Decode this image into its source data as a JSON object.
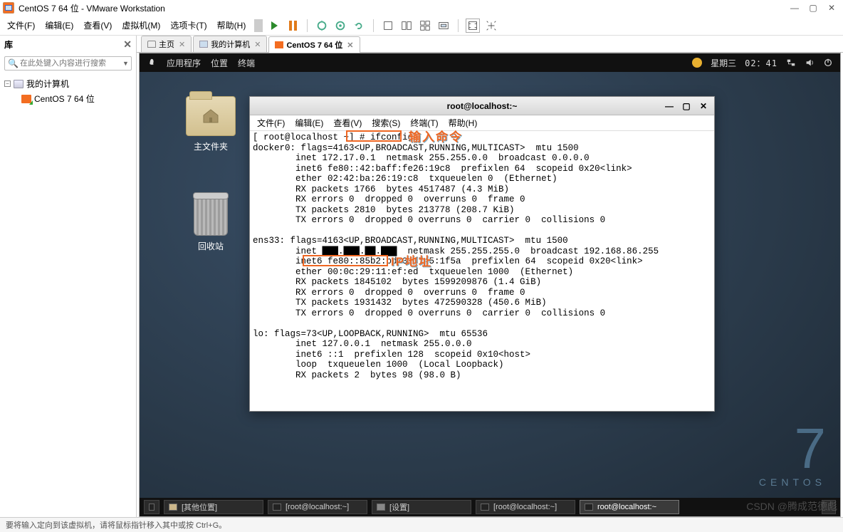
{
  "app": {
    "title": "CentOS 7 64 位 - VMware Workstation"
  },
  "win_controls": {
    "min": "—",
    "max": "▢",
    "close": "✕"
  },
  "menu": {
    "file": "文件(F)",
    "edit": "编辑(E)",
    "view": "查看(V)",
    "vm": "虚拟机(M)",
    "tabs": "选项卡(T)",
    "help": "帮助(H)"
  },
  "sidebar": {
    "title": "库",
    "search_placeholder": "在此处键入内容进行搜索",
    "root": "我的计算机",
    "vm": "CentOS 7 64 位"
  },
  "tabs": {
    "home": "主页",
    "mypc": "我的计算机",
    "vm": "CentOS 7 64 位"
  },
  "gnome": {
    "apps": "应用程序",
    "places": "位置",
    "terminal": "终端",
    "day": "星期三",
    "time": "02：41"
  },
  "desktop": {
    "home": "主文件夹",
    "trash": "回收站"
  },
  "centos": {
    "seven": "7",
    "word": "CENTOS"
  },
  "term": {
    "title": "root@localhost:~",
    "menu": {
      "file": "文件(F)",
      "edit": "编辑(E)",
      "view": "查看(V)",
      "search": "搜索(S)",
      "terminal": "终端(T)",
      "help": "帮助(H)"
    },
    "prompt": "[ root@localhost ~] # ifconfig",
    "output_lines": [
      "docker0: flags=4163<UP,BROADCAST,RUNNING,MULTICAST>  mtu 1500",
      "        inet 172.17.0.1  netmask 255.255.0.0  broadcast 0.0.0.0",
      "        inet6 fe80::42:baff:fe26:19c8  prefixlen 64  scopeid 0x20<link>",
      "        ether 02:42:ba:26:19:c8  txqueuelen 0  (Ethernet)",
      "        RX packets 1766  bytes 4517487 (4.3 MiB)",
      "        RX errors 0  dropped 0  overruns 0  frame 0",
      "        TX packets 2810  bytes 213778 (208.7 KiB)",
      "        TX errors 0  dropped 0 overruns 0  carrier 0  collisions 0",
      "",
      "ens33: flags=4163<UP,BROADCAST,RUNNING,MULTICAST>  mtu 1500",
      "        inet ███.███.██.███  netmask 255.255.255.0  broadcast 192.168.86.255",
      "        inet6 fe80::85b2:bd73:d745:1f5a  prefixlen 64  scopeid 0x20<link>",
      "        ether 00:0c:29:11:ef:ed  txqueuelen 1000  (Ethernet)",
      "        RX packets 1845102  bytes 1599209876 (1.4 GiB)",
      "        RX errors 0  dropped 0  overruns 0  frame 0",
      "        TX packets 1931432  bytes 472590328 (450.6 MiB)",
      "        TX errors 0  dropped 0 overruns 0  carrier 0  collisions 0",
      "",
      "lo: flags=73<UP,LOOPBACK,RUNNING>  mtu 65536",
      "        inet 127.0.0.1  netmask 255.0.0.0",
      "        inet6 ::1  prefixlen 128  scopeid 0x10<host>",
      "        loop  txqueuelen 1000  (Local Loopback)",
      "        RX packets 2  bytes 98 (98.0 B)"
    ]
  },
  "annotations": {
    "input_cmd": "输入命令",
    "ip_addr": "IP地址"
  },
  "vm_taskbar": {
    "other": "[其他位置]",
    "t1": "[root@localhost:~]",
    "settings": "[设置]",
    "t2": "[root@localhost:~]",
    "t3": "root@localhost:~"
  },
  "statusbar": {
    "msg": "要将输入定向到该虚拟机，请将鼠标指针移入其中或按 Ctrl+G。"
  },
  "watermark": "CSDN @腾成范德彪"
}
